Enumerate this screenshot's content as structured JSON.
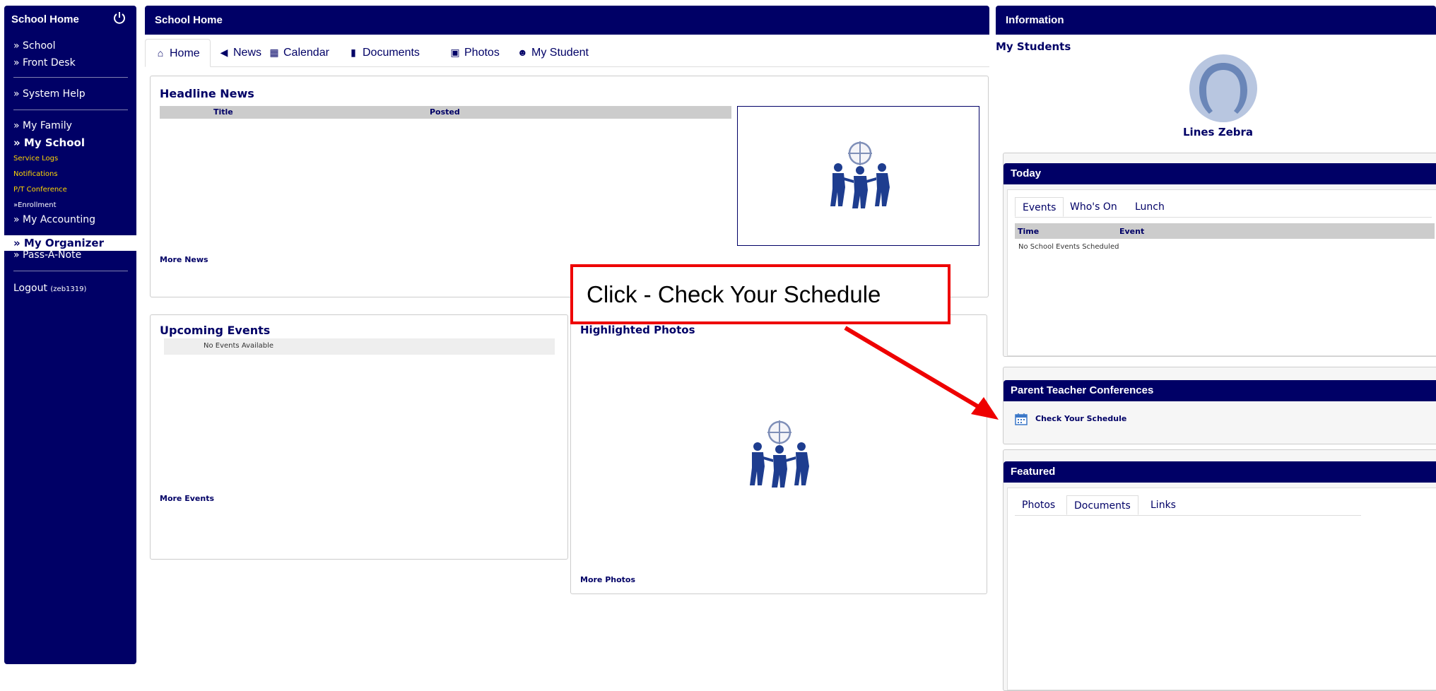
{
  "sidebar": {
    "title": "School Home",
    "items": [
      {
        "label": "» School"
      },
      {
        "label": "» Front Desk"
      },
      {
        "label": "» System Help"
      },
      {
        "label": "» My Family"
      },
      {
        "label": "» My School"
      },
      {
        "label": "Service Logs"
      },
      {
        "label": "Notifications"
      },
      {
        "label": "P/T Conference"
      },
      {
        "label": "»Enrollment"
      },
      {
        "label": "» My Accounting"
      },
      {
        "label": "» My Organizer"
      },
      {
        "label": "» Pass-A-Note"
      }
    ],
    "logout": {
      "label": "Logout",
      "user": "(zeb1319)"
    }
  },
  "main": {
    "header": "School Home",
    "tabs": [
      {
        "label": "Home",
        "icon": "home-icon"
      },
      {
        "label": "News",
        "icon": "megaphone-icon"
      },
      {
        "label": "Calendar",
        "icon": "calendar-icon"
      },
      {
        "label": "Documents",
        "icon": "document-icon"
      },
      {
        "label": "Photos",
        "icon": "camera-icon"
      },
      {
        "label": "My Student",
        "icon": "user-icon"
      }
    ],
    "headline_news": {
      "title": "Headline News",
      "columns": [
        "Title",
        "Posted"
      ],
      "more": "More News"
    },
    "upcoming_events": {
      "title": "Upcoming Events",
      "empty": "No Events Available",
      "more": "More Events"
    },
    "highlighted_photos": {
      "title": "Highlighted Photos",
      "more": "More Photos"
    }
  },
  "info": {
    "header": "Information",
    "my_students": {
      "title": "My Students",
      "student_name": "Lines Zebra"
    },
    "today": {
      "title": "Today",
      "tabs": [
        "Events",
        "Who's On",
        "Lunch"
      ],
      "columns": [
        "Time",
        "Event"
      ],
      "empty": "No School Events Scheduled"
    },
    "ptc": {
      "title": "Parent Teacher Conferences",
      "link": "Check Your Schedule"
    },
    "featured": {
      "title": "Featured",
      "tabs": [
        "Photos",
        "Documents",
        "Links"
      ]
    }
  },
  "callout": {
    "text": "Click - Check Your Schedule"
  },
  "colors": {
    "navy": "#000066",
    "accent_yellow": "#ffd700",
    "callout_red": "#ee0000"
  }
}
